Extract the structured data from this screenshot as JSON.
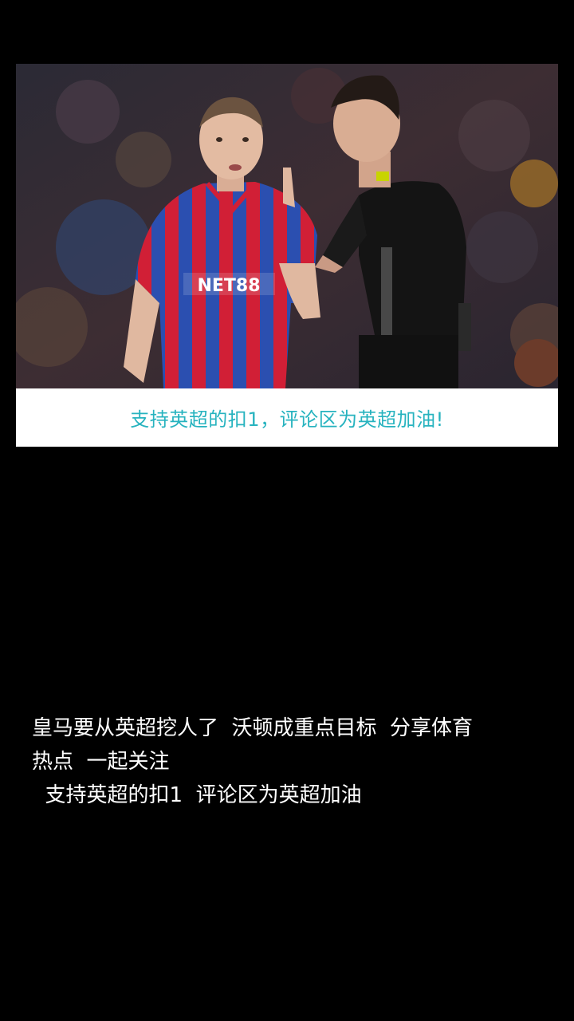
{
  "media": {
    "photo_caption": "支持英超的扣1，评论区为英超加油!",
    "jersey_text": "NET88",
    "colors": {
      "caption_text": "#27b3bf",
      "caption_bar": "#ffffff",
      "background": "#000000",
      "jersey_blue": "#2b4fb0",
      "jersey_red": "#d11f36",
      "referee_kit": "#111111"
    }
  },
  "post": {
    "lines": [
      "皇马要从英超挖人了  沃顿成重点目标  分享体育",
      "热点  一起关注",
      "  支持英超的扣1  评论区为英超加油"
    ]
  }
}
